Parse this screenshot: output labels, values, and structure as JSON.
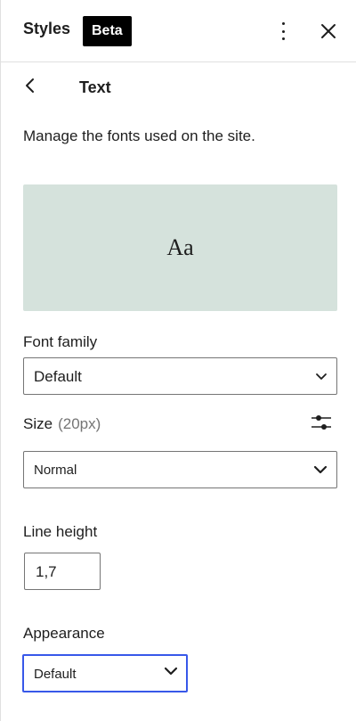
{
  "header": {
    "title": "Styles",
    "badge": "Beta"
  },
  "nav": {
    "heading": "Text"
  },
  "description": "Manage the fonts used on the site.",
  "preview": {
    "sample": "Aa",
    "background": "#d5e2dc"
  },
  "font_family": {
    "label": "Font family",
    "value": "Default"
  },
  "size": {
    "label": "Size",
    "current": "(20px)",
    "value": "Normal"
  },
  "line_height": {
    "label": "Line height",
    "value": "1,7"
  },
  "appearance": {
    "label": "Appearance",
    "value": "Default",
    "accent": "#3858e9"
  },
  "icons": {
    "more": "more-vertical-icon",
    "close": "close-icon",
    "back": "chevron-left-icon",
    "settings": "sliders-icon",
    "dropdown": "chevron-down-icon"
  }
}
